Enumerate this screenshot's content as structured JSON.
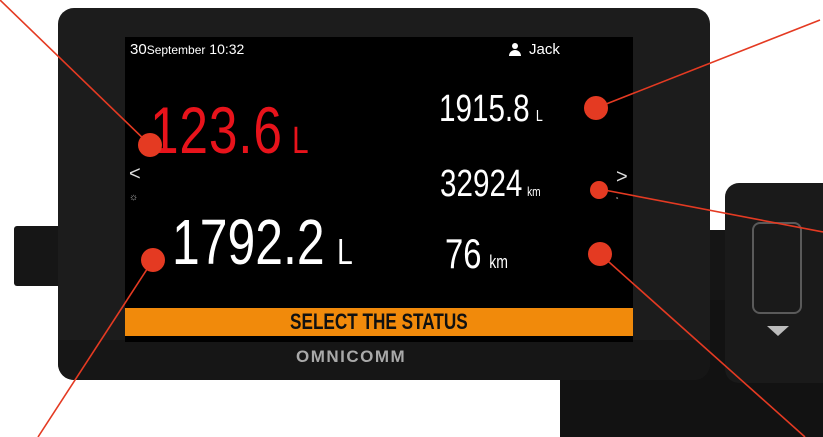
{
  "header": {
    "day": "30",
    "month": "September",
    "time": "10:32",
    "user_name": "Jack"
  },
  "readings": {
    "main_red_value": "123.6",
    "main_red_unit": "L",
    "main_white_value": "1792.2",
    "main_white_unit": "L",
    "right_top_value": "1915.8",
    "right_top_unit": "L",
    "right_mid_value": "32924",
    "right_mid_unit": "km",
    "right_bottom_value": "76",
    "right_bottom_unit": "km"
  },
  "navigation": {
    "left_arrow": "<",
    "right_arrow": ">"
  },
  "status_bar": {
    "label": "SELECT THE STATUS"
  },
  "brand": {
    "name": "OMNICOMM"
  },
  "icons": [
    "user-icon",
    "sun-icon",
    "gauge-icon",
    "chevron-left-icon",
    "chevron-right-icon",
    "chevron-down-icon"
  ],
  "colors": {
    "red_value": "#e8131b",
    "status_bar": "#f18a0b",
    "callout": "#e43a22",
    "screen": "#000000"
  }
}
